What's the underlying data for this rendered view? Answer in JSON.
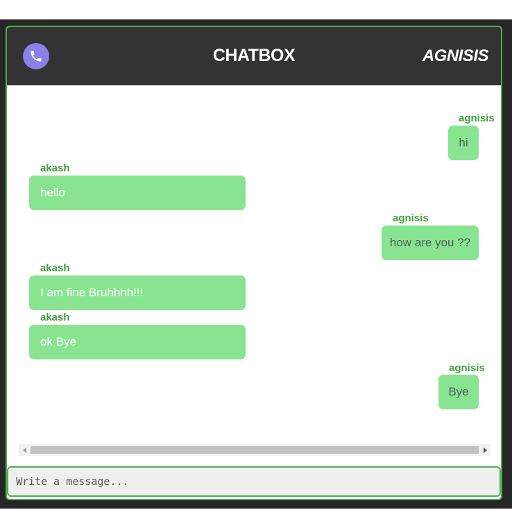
{
  "header": {
    "title": "CHATBOX",
    "user_name": "AGNISIS",
    "call_icon": "phone-icon"
  },
  "messages": [
    {
      "sender": "agnisis",
      "text": "hi",
      "side": "right"
    },
    {
      "sender": "akash",
      "text": "hello",
      "side": "left"
    },
    {
      "sender": "agnisis",
      "text": "how are you ??",
      "side": "right"
    },
    {
      "sender": "akash",
      "text": "I am fine Bruhhhh!!!",
      "side": "left"
    },
    {
      "sender": "akash",
      "text": "ok Bye",
      "side": "left"
    },
    {
      "sender": "agnisis",
      "text": "Bye",
      "side": "right"
    }
  ],
  "input": {
    "placeholder": "Write a message...",
    "value": ""
  },
  "colors": {
    "header_bg": "#333333",
    "accent_green": "#4caf50",
    "bubble_green": "#88e490",
    "sender_green": "#3f9e3f",
    "call_button": "#8b7fe8"
  }
}
